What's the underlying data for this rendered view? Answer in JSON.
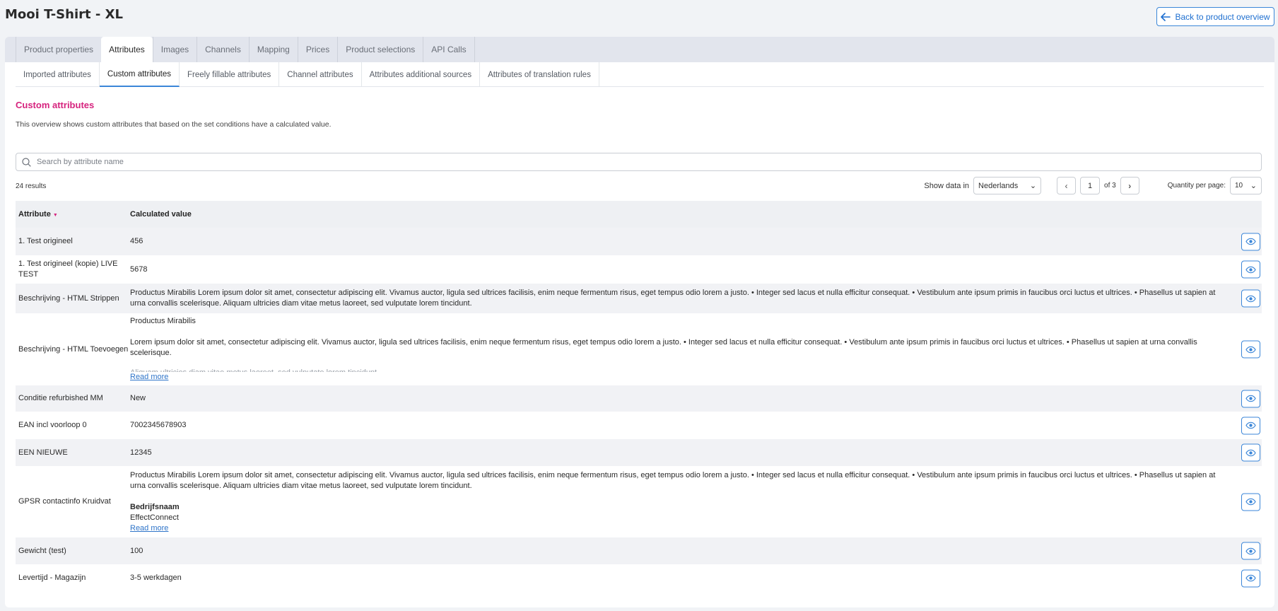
{
  "page": {
    "title": "Mooi T-Shirt - XL",
    "back_button": "Back to product overview"
  },
  "tabs": [
    {
      "label": "Product properties"
    },
    {
      "label": "Attributes"
    },
    {
      "label": "Images"
    },
    {
      "label": "Channels"
    },
    {
      "label": "Mapping"
    },
    {
      "label": "Prices"
    },
    {
      "label": "Product selections"
    },
    {
      "label": "API Calls"
    }
  ],
  "active_tab": "Attributes",
  "subtabs": [
    {
      "label": "Imported attributes"
    },
    {
      "label": "Custom attributes"
    },
    {
      "label": "Freely fillable attributes"
    },
    {
      "label": "Channel attributes"
    },
    {
      "label": "Attributes additional sources"
    },
    {
      "label": "Attributes of translation rules"
    }
  ],
  "active_subtab": "Custom attributes",
  "section": {
    "title": "Custom attributes",
    "description": "This overview shows custom attributes that based on the set conditions have a calculated value."
  },
  "search": {
    "placeholder": "Search by attribute name",
    "value": ""
  },
  "results_text": "24 results",
  "controls": {
    "show_data_label": "Show data in",
    "language": "Nederlands",
    "page": "1",
    "of_pages": "of 3",
    "qty_label": "Quantity per page:",
    "qty_value": "10"
  },
  "table": {
    "headers": {
      "attribute": "Attribute",
      "value": "Calculated value"
    },
    "read_more": "Read more",
    "rows": [
      {
        "attr": "1. Test origineel",
        "value": "456"
      },
      {
        "attr": "1. Test origineel (kopie) LIVE TEST",
        "value": "5678"
      },
      {
        "attr": "Beschrijving - HTML Strippen",
        "value": "Productus Mirabilis Lorem ipsum dolor sit amet, consectetur adipiscing elit. Vivamus auctor, ligula sed ultrices facilisis, enim neque fermentum risus, eget tempus odio lorem a justo. • Integer sed lacus et nulla efficitur consequat. • Vestibulum ante ipsum primis in faucibus orci luctus et ultrices. • Phasellus ut sapien at urna convallis scelerisque. Aliquam ultricies diam vitae metus laoreet, sed vulputate lorem tincidunt."
      },
      {
        "attr": "Beschrijving - HTML Toevoegen",
        "value_title": "Productus Mirabilis",
        "value": "Lorem ipsum dolor sit amet, consectetur adipiscing elit. Vivamus auctor, ligula sed ultrices facilisis, enim neque fermentum risus, eget tempus odio lorem a justo. • Integer sed lacus et nulla efficitur consequat. • Vestibulum ante ipsum primis in faucibus orci luctus et ultrices. • Phasellus ut sapien at urna convallis scelerisque.",
        "value_faded": "Aliquam ultricies diam vitae metus laoreet, sed vulputate lorem tincidunt."
      },
      {
        "attr": "Conditie refurbished MM",
        "value": "New"
      },
      {
        "attr": "EAN incl voorloop 0",
        "value": "7002345678903"
      },
      {
        "attr": "EEN NIEUWE",
        "value": "12345"
      },
      {
        "attr": "GPSR contactinfo Kruidvat",
        "value": "Productus Mirabilis Lorem ipsum dolor sit amet, consectetur adipiscing elit. Vivamus auctor, ligula sed ultrices facilisis, enim neque fermentum risus, eget tempus odio lorem a justo. • Integer sed lacus et nulla efficitur consequat. • Vestibulum ante ipsum primis in faucibus orci luctus et ultrices. • Phasellus ut sapien at urna convallis scelerisque. Aliquam ultricies diam vitae metus laoreet, sed vulputate lorem tincidunt.",
        "value_bold": "Bedrijfsnaam",
        "value_extra": "EffectConnect"
      },
      {
        "attr": "Gewicht (test)",
        "value": "100"
      },
      {
        "attr": "Levertijd - Magazijn",
        "value": "3-5 werkdagen"
      }
    ]
  },
  "colors": {
    "accent_blue": "#3b86d8",
    "section_title_pink": "#d6237e"
  },
  "icons": [
    "arrow-left-icon",
    "search-icon",
    "chevron-down-icon",
    "chevron-left-icon",
    "chevron-right-icon",
    "eye-icon"
  ]
}
